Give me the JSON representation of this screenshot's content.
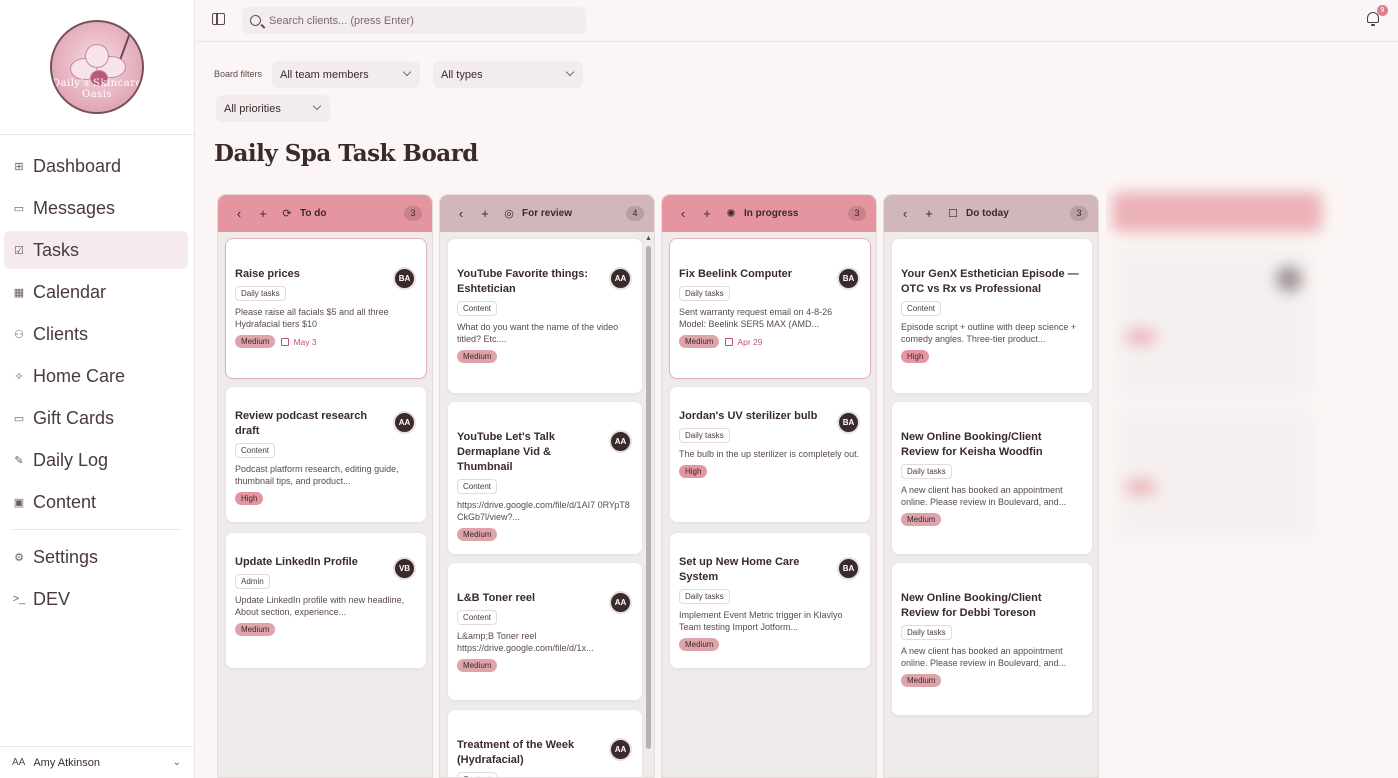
{
  "sidebar": {
    "logo_text": "Daily's Skincare Oasis",
    "items": [
      {
        "label": "Dashboard",
        "icon": "grid-icon",
        "glyph": "⊞"
      },
      {
        "label": "Messages",
        "icon": "message-icon",
        "glyph": "▭"
      },
      {
        "label": "Tasks",
        "icon": "check-square-icon",
        "glyph": "☑"
      },
      {
        "label": "Calendar",
        "icon": "calendar-icon",
        "glyph": "▦"
      },
      {
        "label": "Clients",
        "icon": "users-icon",
        "glyph": "⚇"
      },
      {
        "label": "Home Care",
        "icon": "sparkle-icon",
        "glyph": "✧"
      },
      {
        "label": "Gift Cards",
        "icon": "card-icon",
        "glyph": "▭"
      },
      {
        "label": "Daily Log",
        "icon": "edit-icon",
        "glyph": "✎"
      },
      {
        "label": "Content",
        "icon": "media-icon",
        "glyph": "▣"
      },
      {
        "label": "Settings",
        "icon": "gear-icon",
        "glyph": "⚙"
      },
      {
        "label": "DEV",
        "icon": "terminal-icon",
        "glyph": ">_"
      }
    ],
    "active": "Tasks",
    "user": {
      "initials": "AA",
      "name": "Amy Atkinson"
    }
  },
  "topbar": {
    "search_placeholder": "Search clients... (press Enter)",
    "notification_count": "9"
  },
  "filters": {
    "label": "Board filters",
    "team": "All team members",
    "types": "All types",
    "priorities": "All priorities"
  },
  "page_title": "Daily Spa Task Board",
  "columns": [
    {
      "title": "To do",
      "count": "3",
      "icon": "refresh-icon",
      "glyph": "⟳",
      "cards": [
        {
          "title": "Raise prices",
          "tag": "Daily tasks",
          "desc": "Please raise all facials $5 and all three Hydrafacial tiers $10",
          "priority": "Medium",
          "due": "May 3",
          "avatar": "BA"
        },
        {
          "title": "Review podcast research draft",
          "tag": "Content",
          "desc": "Podcast platform research, editing guide, thumbnail tips, and product...",
          "priority": "High",
          "due": "",
          "avatar": "AA"
        },
        {
          "title": "Update LinkedIn Profile",
          "tag": "Admin",
          "desc": "Update LinkedIn profile with new headline, About section, experience...",
          "priority": "Medium",
          "due": "",
          "avatar": "VB"
        }
      ]
    },
    {
      "title": "For review",
      "count": "4",
      "icon": "target-icon",
      "glyph": "◎",
      "cards": [
        {
          "title": "YouTube Favorite things: Eshtetician",
          "tag": "Content",
          "desc": "What do you want the name of the video titled? Etc....",
          "priority": "Medium",
          "due": "",
          "avatar": "AA"
        },
        {
          "title": "YouTube Let's Talk Dermaplane Vid & Thumbnail",
          "tag": "Content",
          "desc": "https://drive.google.com/file/d/1AI7 0RYpT8CkGb7l/view?...",
          "priority": "Medium",
          "due": "",
          "avatar": "AA"
        },
        {
          "title": "L&B Toner reel",
          "tag": "Content",
          "desc": "L&amp;B Toner reel https://drive.google.com/file/d/1x...",
          "priority": "Medium",
          "due": "",
          "avatar": "AA"
        },
        {
          "title": "Treatment of the Week (Hydrafacial)",
          "tag": "Content",
          "desc": "",
          "priority": "",
          "due": "",
          "avatar": "AA"
        }
      ]
    },
    {
      "title": "In progress",
      "count": "3",
      "icon": "loader-icon",
      "glyph": "✺",
      "cards": [
        {
          "title": "Fix Beelink Computer",
          "tag": "Daily tasks",
          "desc": "Sent warranty request email on 4-8-26 Model: Beelink SER5 MAX (AMD...",
          "priority": "Medium",
          "due": "Apr 29",
          "avatar": "BA"
        },
        {
          "title": "Jordan's UV sterilizer bulb",
          "tag": "Daily tasks",
          "desc": "The bulb in the up sterilizer is completely out.",
          "priority": "High",
          "due": "",
          "avatar": "BA"
        },
        {
          "title": "Set up New Home Care System",
          "tag": "Daily tasks",
          "desc": "Implement Event Metric trigger in Klavlyo Team testing Import Jotform...",
          "priority": "Medium",
          "due": "",
          "avatar": "BA"
        }
      ]
    },
    {
      "title": "Do today",
      "count": "3",
      "icon": "square-icon",
      "glyph": "☐",
      "cards": [
        {
          "title": "Your GenX Esthetician Episode — OTC vs Rx vs Professional",
          "tag": "Content",
          "desc": "Episode script + outline with deep science + comedy angles. Three-tier product...",
          "priority": "High",
          "due": "",
          "avatar": ""
        },
        {
          "title": "New Online Booking/Client Review for Keisha Woodfin",
          "tag": "Daily tasks",
          "desc": "A new client has booked an appointment online. Please review in Boulevard, and...",
          "priority": "Medium",
          "due": "",
          "avatar": ""
        },
        {
          "title": "New Online Booking/Client Review for Debbi Toreson",
          "tag": "Daily tasks",
          "desc": "A new client has booked an appointment online. Please review in Boulevard, and...",
          "priority": "Medium",
          "due": "",
          "avatar": ""
        }
      ]
    }
  ],
  "colors": {
    "accent_pink": "#e5959f",
    "accent_mauve": "#d1b6ba",
    "avatar_dark": "#3a2a2c",
    "due_red": "#c0566a"
  }
}
